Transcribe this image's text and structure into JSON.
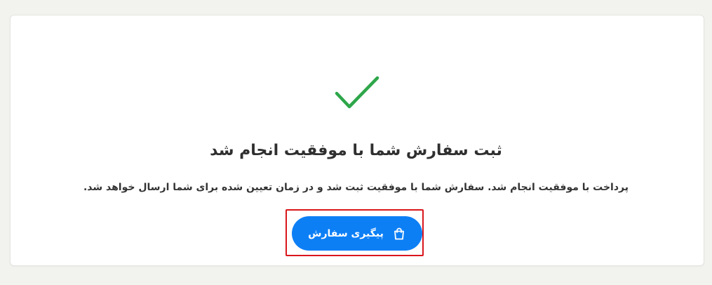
{
  "confirmation": {
    "title": "ثبت سفارش شما با موفقیت انجام شد",
    "message": "پرداخت با موفقیت انجام شد. سفارش شما با موفقیت ثبت شد و در زمان تعیین شده برای شما ارسال خواهد شد.",
    "status_icon": "check-icon",
    "success_color": "#2ea64a"
  },
  "actions": {
    "track_order_label": "پیگیری سفارش",
    "track_order_icon": "shopping-bag-icon",
    "button_color": "#0d7ff5"
  }
}
